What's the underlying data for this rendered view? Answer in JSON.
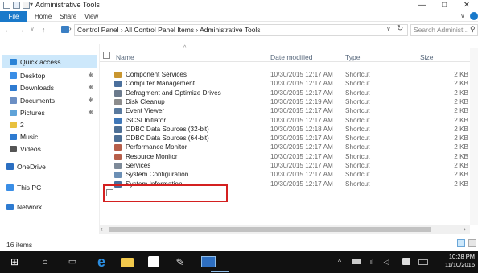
{
  "window": {
    "title": "Administrative Tools",
    "minimize_glyph": "—",
    "maximize_glyph": "□",
    "close_glyph": "✕"
  },
  "ribbon": {
    "file_tab": "File",
    "tabs": [
      "Home",
      "Share",
      "View"
    ]
  },
  "address": {
    "breadcrumbs": "Control Panel  ›  All Control Panel Items  ›  Administrative Tools",
    "search_placeholder": "Search Administ..."
  },
  "nav_pane": {
    "items": [
      {
        "label": "Quick access",
        "icon": "star-icon",
        "color": "#2b83d6",
        "selected": true
      },
      {
        "label": "Desktop",
        "icon": "desktop-folder-icon",
        "color": "#3a8ee6",
        "pinned": true
      },
      {
        "label": "Downloads",
        "icon": "downloads-folder-icon",
        "color": "#2e7bd1",
        "pinned": true
      },
      {
        "label": "Documents",
        "icon": "documents-folder-icon",
        "color": "#6b8fc4",
        "pinned": true
      },
      {
        "label": "Pictures",
        "icon": "pictures-folder-icon",
        "color": "#5fa3d8",
        "pinned": true
      },
      {
        "label": "2",
        "icon": "folder-icon",
        "color": "#e8c13f"
      },
      {
        "label": "Music",
        "icon": "music-folder-icon",
        "color": "#2e7bd1"
      },
      {
        "label": "Videos",
        "icon": "videos-folder-icon",
        "color": "#555"
      },
      {
        "label": "OneDrive",
        "icon": "onedrive-icon",
        "color": "#2b6fc2"
      },
      {
        "label": "This PC",
        "icon": "this-pc-icon",
        "color": "#3a8ee6"
      },
      {
        "label": "Network",
        "icon": "network-icon",
        "color": "#2e7bd1"
      }
    ],
    "pin_glyph": "✱"
  },
  "columns": {
    "name": "Name",
    "date": "Date modified",
    "type": "Type",
    "size": "Size"
  },
  "files": [
    {
      "name": "Component Services",
      "date": "10/30/2015 12:17 AM",
      "type": "Shortcut",
      "size": "2 KB",
      "icon": "component-services-icon",
      "color": "#c9962f"
    },
    {
      "name": "Computer Management",
      "date": "10/30/2015 12:17 AM",
      "type": "Shortcut",
      "size": "2 KB",
      "icon": "computer-management-icon",
      "color": "#4a6f9c"
    },
    {
      "name": "Defragment and Optimize Drives",
      "date": "10/30/2015 12:17 AM",
      "type": "Shortcut",
      "size": "2 KB",
      "icon": "defragment-icon",
      "color": "#6b7a8c"
    },
    {
      "name": "Disk Cleanup",
      "date": "10/30/2015 12:19 AM",
      "type": "Shortcut",
      "size": "2 KB",
      "icon": "disk-cleanup-icon",
      "color": "#8c8c8c"
    },
    {
      "name": "Event Viewer",
      "date": "10/30/2015 12:17 AM",
      "type": "Shortcut",
      "size": "2 KB",
      "icon": "event-viewer-icon",
      "color": "#5a7a9e"
    },
    {
      "name": "iSCSI Initiator",
      "date": "10/30/2015 12:17 AM",
      "type": "Shortcut",
      "size": "2 KB",
      "icon": "iscsi-icon",
      "color": "#3f77b8"
    },
    {
      "name": "ODBC Data Sources (32-bit)",
      "date": "10/30/2015 12:18 AM",
      "type": "Shortcut",
      "size": "2 KB",
      "icon": "odbc-icon",
      "color": "#4d6f95"
    },
    {
      "name": "ODBC Data Sources (64-bit)",
      "date": "10/30/2015 12:17 AM",
      "type": "Shortcut",
      "size": "2 KB",
      "icon": "odbc-icon",
      "color": "#4d6f95"
    },
    {
      "name": "Performance Monitor",
      "date": "10/30/2015 12:17 AM",
      "type": "Shortcut",
      "size": "2 KB",
      "icon": "performance-monitor-icon",
      "color": "#b65e4a"
    },
    {
      "name": "Resource Monitor",
      "date": "10/30/2015 12:17 AM",
      "type": "Shortcut",
      "size": "2 KB",
      "icon": "resource-monitor-icon",
      "color": "#b65e4a"
    },
    {
      "name": "Services",
      "date": "10/30/2015 12:17 AM",
      "type": "Shortcut",
      "size": "2 KB",
      "icon": "services-icon",
      "color": "#7d8a99"
    },
    {
      "name": "System Configuration",
      "date": "10/30/2015 12:17 AM",
      "type": "Shortcut",
      "size": "2 KB",
      "icon": "system-configuration-icon",
      "color": "#6b8fb5"
    },
    {
      "name": "System Information",
      "date": "10/30/2015 12:17 AM",
      "type": "Shortcut",
      "size": "2 KB",
      "icon": "system-information-icon",
      "color": "#4a6f9c"
    }
  ],
  "status": {
    "item_count": "16 items"
  },
  "taskbar": {
    "time": "10:28 PM",
    "date": "11/10/2016",
    "apps": [
      "start-icon",
      "search-icon",
      "task-view-icon",
      "edge-icon",
      "file-explorer-icon",
      "store-icon",
      "paint-icon",
      "control-panel-icon"
    ]
  },
  "colors": {
    "accent": "#1979ca",
    "selection": "#cde8fb",
    "highlight_border": "#d42020"
  }
}
